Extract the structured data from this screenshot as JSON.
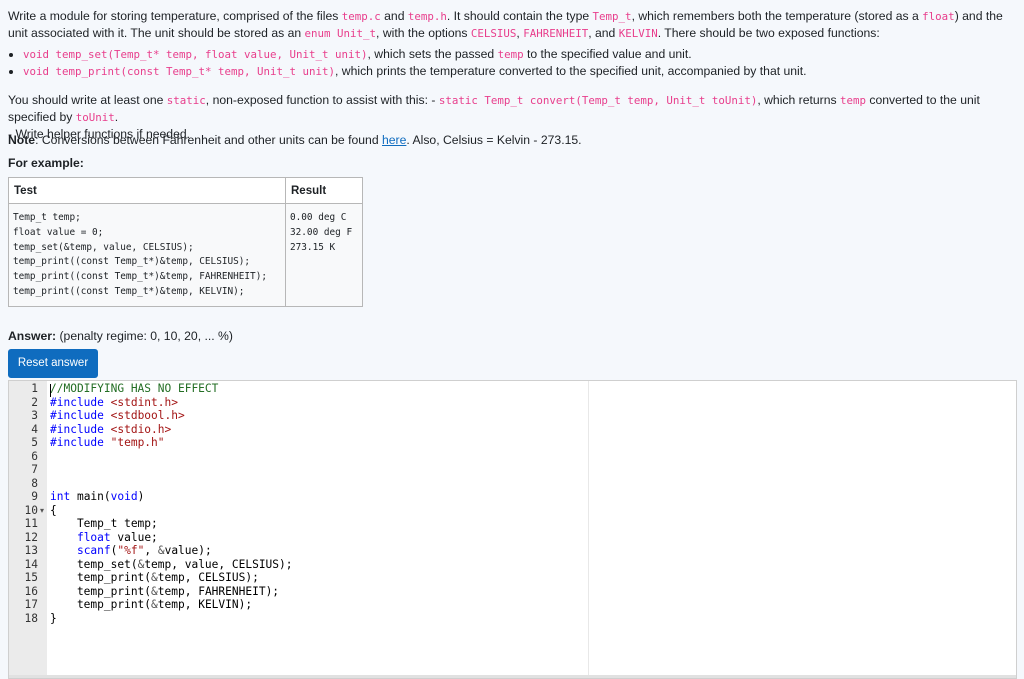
{
  "question": {
    "intro": {
      "t1": "Write a module for storing temperature, comprised of the files ",
      "c1": "temp.c",
      "t2": " and ",
      "c2": "temp.h",
      "t3": ". It should contain the type ",
      "c3": "Temp_t",
      "t4": ", which remembers both the temperature (stored as a ",
      "c4": "float",
      "t5": ") and the unit associated with it. The unit should be stored as an ",
      "c5": "enum Unit_t",
      "t6": ", with the options ",
      "c6": "CELSIUS",
      "t7": ", ",
      "c7": "FAHRENHEIT",
      "t8": ", and ",
      "c8": "KELVIN",
      "t9": ". There should be two exposed functions:"
    },
    "functions": [
      {
        "code": "void temp_set(Temp_t* temp, float value, Unit_t unit)",
        "t1": ", which sets the passed ",
        "code2": "temp",
        "t2": " to the specified value and unit."
      },
      {
        "code": "void temp_print(const Temp_t* temp, Unit_t unit)",
        "t1": ", which prints the temperature converted to the specified unit, accompanied by that unit.",
        "code2": "",
        "t2": ""
      }
    ],
    "helper": {
      "t1": "You should write at least one ",
      "c1": "static",
      "t2": ", non-exposed function to assist with this: - ",
      "c2": "static Temp_t convert(Temp_t temp, Unit_t toUnit)",
      "t3": ", which returns ",
      "c3": "temp",
      "t4": " converted to the unit specified by ",
      "c4": "toUnit",
      "t5": ".",
      "line2": "- Write helper functions if needed."
    },
    "note": {
      "label": "Note",
      "t1": ": Conversions between Fahrenheit and other units can be found ",
      "link": "here",
      "t2": ". Also, Celsius = Kelvin - 273.15."
    },
    "for_example": "For example:"
  },
  "example_table": {
    "headers": [
      "Test",
      "Result"
    ],
    "test_code": "Temp_t temp;\nfloat value = 0;\ntemp_set(&temp, value, CELSIUS);\ntemp_print((const Temp_t*)&temp, CELSIUS);\ntemp_print((const Temp_t*)&temp, FAHRENHEIT);\ntemp_print((const Temp_t*)&temp, KELVIN);",
    "result": "0.00 deg C\n32.00 deg F\n273.15 K"
  },
  "answer": {
    "label": "Answer:",
    "penalty": "(penalty regime: 0, 10, 20, ... %)",
    "reset_button": "Reset answer"
  },
  "editor": {
    "line_numbers": [
      "1",
      "2",
      "3",
      "4",
      "5",
      "6",
      "7",
      "8",
      "9",
      "10",
      "11",
      "12",
      "13",
      "14",
      "15",
      "16",
      "17",
      "18"
    ],
    "lines": [
      "//MODIFYING HAS NO EFFECT",
      "#include <stdint.h>",
      "#include <stdbool.h>",
      "#include <stdio.h>",
      "#include \"temp.h\"",
      "",
      "",
      "",
      "int main(void)",
      "{",
      "    Temp_t temp;",
      "    float value;",
      "    scanf(\"%f\", &value);",
      "    temp_set(&temp, value, CELSIUS);",
      "    temp_print(&temp, CELSIUS);",
      "    temp_print(&temp, FAHRENHEIT);",
      "    temp_print(&temp, KELVIN);",
      "}"
    ]
  },
  "colors": {
    "accent": "#0f6cbf",
    "code_inline": "#e83e8c",
    "comment": "#236e24",
    "keyword": "#0000ff",
    "string": "#a31515"
  }
}
